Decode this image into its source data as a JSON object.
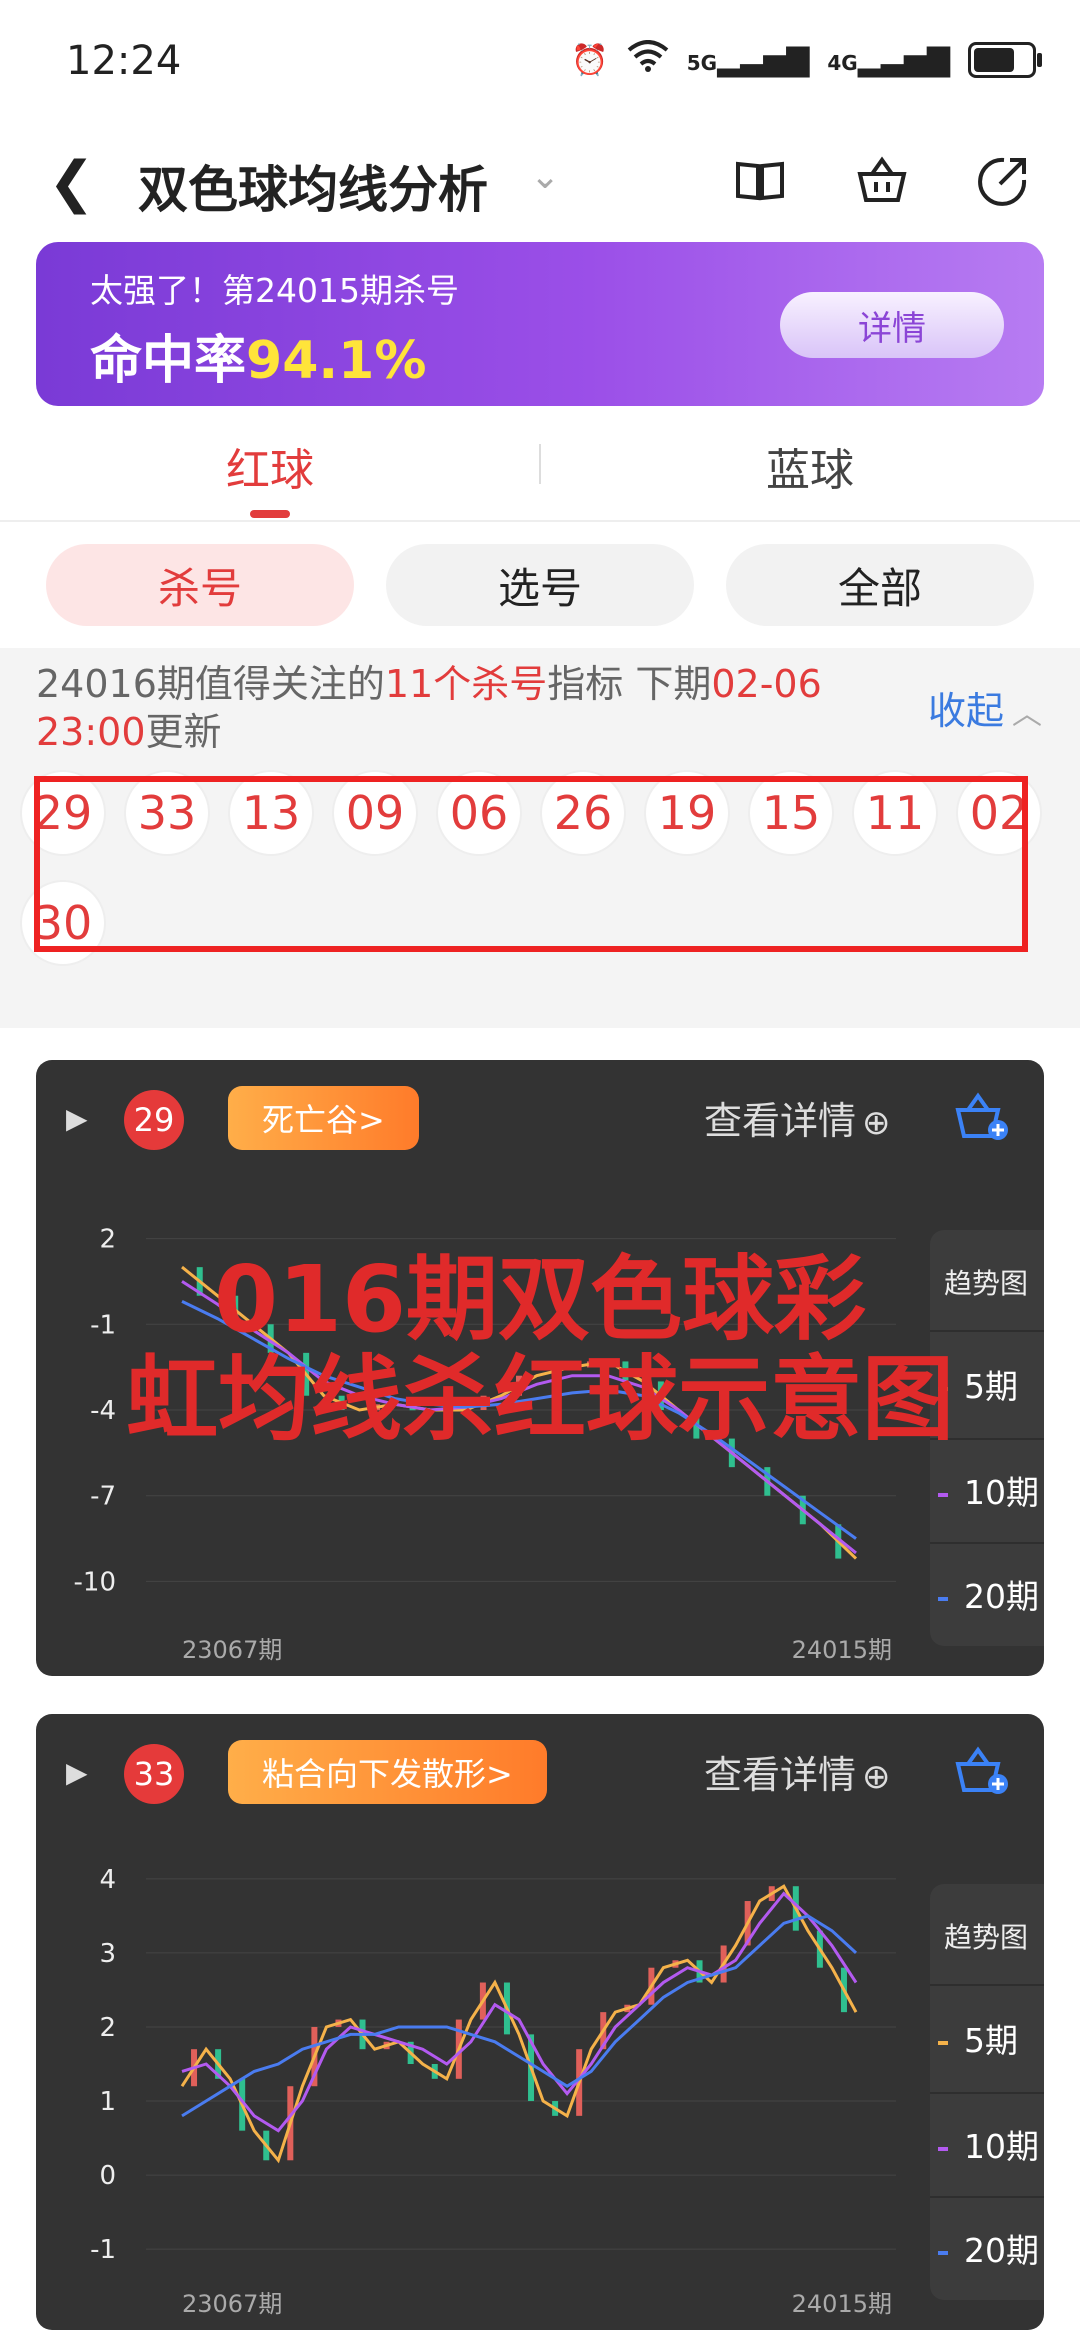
{
  "status": {
    "time": "12:24",
    "net1": "5G",
    "net2": "4G"
  },
  "header": {
    "title": "双色球均线分析"
  },
  "banner": {
    "line1": "太强了！第24015期杀号",
    "line2_prefix": "命中率",
    "rate": "94.1%",
    "button": "详情"
  },
  "tabs": {
    "red": "红球",
    "blue": "蓝球"
  },
  "pills": {
    "kill": "杀号",
    "select": "选号",
    "all": "全部"
  },
  "notice": {
    "part1": "24016期值得关注的",
    "count": "11个杀号",
    "part2": "指标 下期",
    "time": "02-06 23:00",
    "part3": "更新",
    "collapse": "收起"
  },
  "balls": [
    "29",
    "33",
    "13",
    "09",
    "06",
    "26",
    "19",
    "15",
    "11",
    "02",
    "30"
  ],
  "cards": [
    {
      "number": "29",
      "tag": "死亡谷>",
      "detail": "查看详情",
      "legend": {
        "title": "趋势图",
        "items": [
          "5期",
          "10期",
          "20期"
        ]
      },
      "chart_data": {
        "type": "line",
        "yticks": [
          "2",
          "-1",
          "-4",
          "-7",
          "-10"
        ],
        "ylim": [
          -11,
          3
        ],
        "xlabels": [
          "23067期",
          "24015期"
        ],
        "series": [
          {
            "name": "5期",
            "color": "#f5b24a",
            "values": [
              1,
              0,
              -1,
              -2,
              -3.5,
              -4,
              -3.8,
              -4,
              -4,
              -3.5,
              -2.8,
              -2.5,
              -2.3,
              -3,
              -4,
              -5,
              -6,
              -7,
              -8,
              -9.2
            ]
          },
          {
            "name": "10期",
            "color": "#b35af0",
            "values": [
              0.5,
              -0.3,
              -1.2,
              -2,
              -3,
              -3.5,
              -3.8,
              -4,
              -3.9,
              -3.6,
              -3.1,
              -2.8,
              -2.8,
              -3.2,
              -4,
              -5,
              -6,
              -7,
              -8,
              -9
            ]
          },
          {
            "name": "20期",
            "color": "#4a7cf0",
            "values": [
              -0.2,
              -0.8,
              -1.5,
              -2.2,
              -2.8,
              -3.2,
              -3.6,
              -3.8,
              -3.9,
              -3.8,
              -3.6,
              -3.4,
              -3.3,
              -3.5,
              -4.1,
              -4.9,
              -5.8,
              -6.7,
              -7.6,
              -8.5
            ]
          }
        ]
      }
    },
    {
      "number": "33",
      "tag": "粘合向下发散形>",
      "detail": "查看详情",
      "legend": {
        "title": "趋势图",
        "items": [
          "5期",
          "10期",
          "20期"
        ]
      },
      "chart_data": {
        "type": "line",
        "yticks": [
          "4",
          "3",
          "2",
          "1",
          "0",
          "-1"
        ],
        "ylim": [
          -1.2,
          4.2
        ],
        "xlabels": [
          "23067期",
          "24015期"
        ],
        "series": [
          {
            "name": "5期",
            "color": "#f5b24a",
            "values": [
              1.2,
              1.7,
              1.3,
              0.6,
              0.2,
              1.2,
              2.0,
              2.1,
              1.7,
              1.8,
              1.5,
              1.3,
              2.1,
              2.6,
              1.9,
              1.0,
              0.8,
              1.7,
              2.2,
              2.3,
              2.8,
              2.9,
              2.6,
              3.1,
              3.7,
              3.9,
              3.3,
              2.8,
              2.2
            ]
          },
          {
            "name": "10期",
            "color": "#b35af0",
            "values": [
              1.4,
              1.5,
              1.2,
              0.8,
              0.6,
              1.0,
              1.7,
              2.0,
              1.9,
              1.8,
              1.7,
              1.5,
              1.8,
              2.3,
              2.1,
              1.5,
              1.1,
              1.5,
              2.0,
              2.3,
              2.6,
              2.8,
              2.7,
              2.9,
              3.4,
              3.8,
              3.5,
              3.1,
              2.6
            ]
          },
          {
            "name": "20期",
            "color": "#4a7cf0",
            "values": [
              0.8,
              1.0,
              1.2,
              1.4,
              1.5,
              1.7,
              1.8,
              1.9,
              1.9,
              2.0,
              2.0,
              2.0,
              1.9,
              1.8,
              1.6,
              1.4,
              1.2,
              1.4,
              1.8,
              2.1,
              2.4,
              2.6,
              2.7,
              2.8,
              3.1,
              3.4,
              3.5,
              3.3,
              3.0
            ]
          }
        ]
      }
    }
  ],
  "watermark": {
    "line1": "016期双色球彩",
    "line2": "虹均线杀红球示意图"
  }
}
